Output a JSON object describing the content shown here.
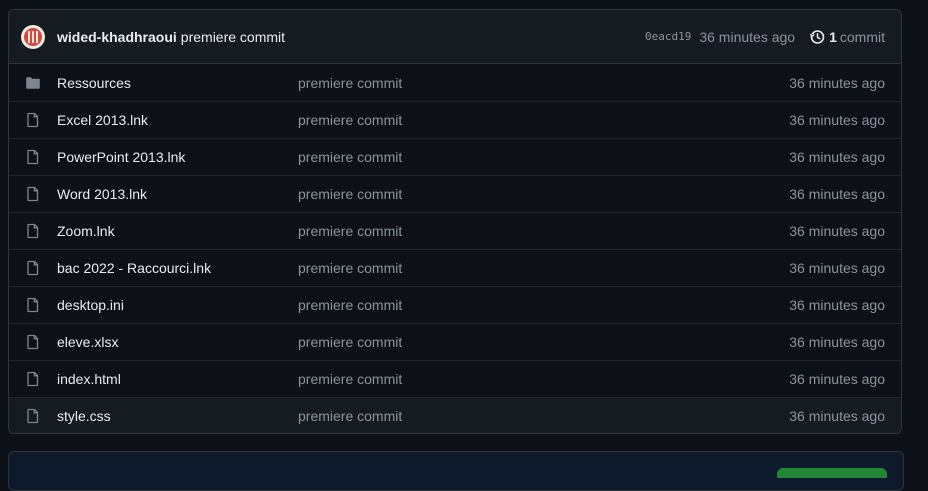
{
  "commit": {
    "author": "wided-khadhraoui",
    "message": "premiere commit",
    "sha": "0eacd19",
    "time": "36 minutes ago",
    "count": "1",
    "count_label": "commit"
  },
  "files": [
    {
      "name": "Ressources",
      "type": "folder",
      "message": "premiere commit",
      "age": "36 minutes ago"
    },
    {
      "name": "Excel 2013.lnk",
      "type": "file",
      "message": "premiere commit",
      "age": "36 minutes ago"
    },
    {
      "name": "PowerPoint 2013.lnk",
      "type": "file",
      "message": "premiere commit",
      "age": "36 minutes ago"
    },
    {
      "name": "Word 2013.lnk",
      "type": "file",
      "message": "premiere commit",
      "age": "36 minutes ago"
    },
    {
      "name": "Zoom.lnk",
      "type": "file",
      "message": "premiere commit",
      "age": "36 minutes ago"
    },
    {
      "name": "bac 2022 - Raccourci.lnk",
      "type": "file",
      "message": "premiere commit",
      "age": "36 minutes ago"
    },
    {
      "name": "desktop.ini",
      "type": "file",
      "message": "premiere commit",
      "age": "36 minutes ago"
    },
    {
      "name": "eleve.xlsx",
      "type": "file",
      "message": "premiere commit",
      "age": "36 minutes ago"
    },
    {
      "name": "index.html",
      "type": "file",
      "message": "premiere commit",
      "age": "36 minutes ago"
    },
    {
      "name": "style.css",
      "type": "file",
      "message": "premiere commit",
      "age": "36 minutes ago"
    }
  ],
  "colors": {
    "background": "#0d1117",
    "header": "#161b22",
    "border": "#30363d",
    "muted_text": "#8b949e",
    "text": "#e6edf3",
    "icon": "#7d8590",
    "avatar": "#d9483f",
    "button": "#238636"
  }
}
